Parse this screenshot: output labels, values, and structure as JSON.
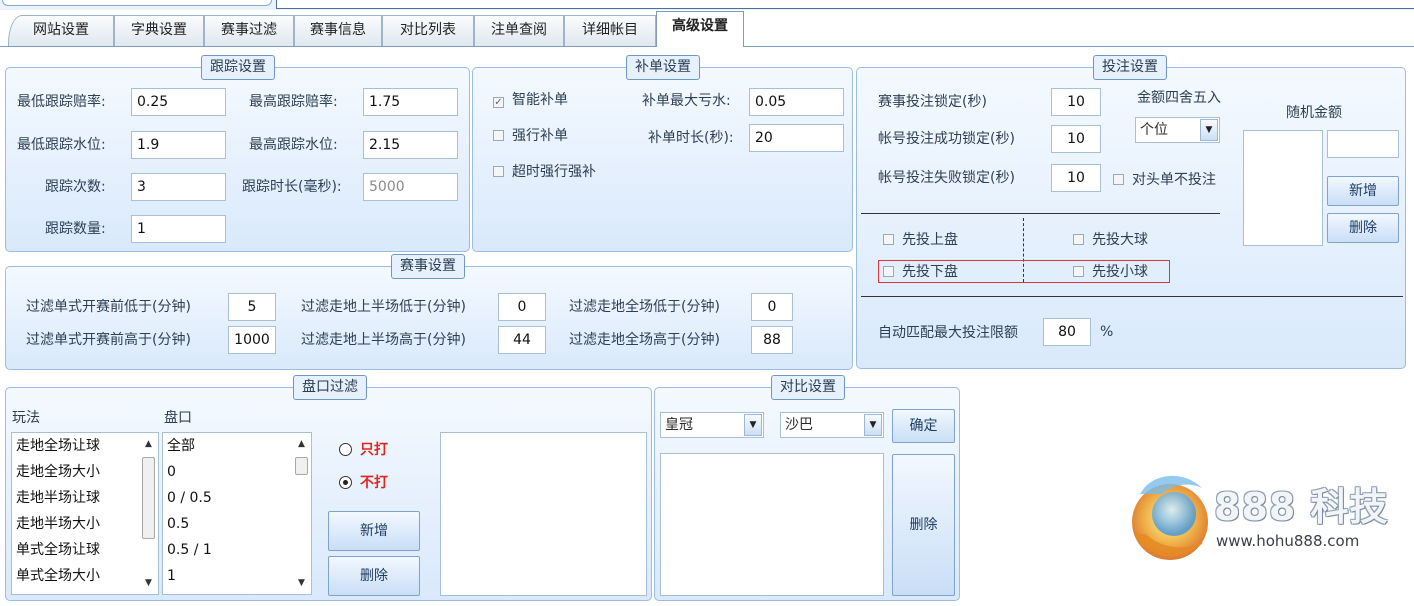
{
  "tabs": [
    "网站设置",
    "字典设置",
    "赛事过滤",
    "赛事信息",
    "对比列表",
    "注单查阅",
    "详细帐目",
    "高级设置"
  ],
  "tracking": {
    "title": "跟踪设置",
    "min_odds_label": "最低跟踪赔率:",
    "min_odds": "0.25",
    "max_odds_label": "最高跟踪赔率:",
    "max_odds": "1.75",
    "min_water_label": "最低跟踪水位:",
    "min_water": "1.9",
    "max_water_label": "最高跟踪水位:",
    "max_water": "2.15",
    "count_label": "跟踪次数:",
    "count": "3",
    "duration_label": "跟踪时长(毫秒):",
    "duration": "5000",
    "quantity_label": "跟踪数量:",
    "quantity": "1"
  },
  "supplement": {
    "title": "补单设置",
    "smart_label": "智能补单",
    "smart_checked": true,
    "forced_label": "强行补单",
    "forced_checked": false,
    "timeout_label": "超时强行强补",
    "timeout_checked": false,
    "max_loss_label": "补单最大亏水:",
    "max_loss": "0.05",
    "duration_label": "补单时长(秒):",
    "duration": "20"
  },
  "betting": {
    "title": "投注设置",
    "event_lock_label": "赛事投注锁定(秒)",
    "event_lock": "10",
    "success_lock_label": "帐号投注成功锁定(秒)",
    "success_lock": "10",
    "fail_lock_label": "帐号投注失败锁定(秒)",
    "fail_lock": "10",
    "rounding_label": "金额四舍五入",
    "rounding_value": "个位",
    "no_opposite_label": "对头单不投注",
    "random_amount_label": "随机金额",
    "add_label": "新增",
    "delete_label": "删除",
    "first_upper_label": "先投上盘",
    "first_big_label": "先投大球",
    "first_lower_label": "先投下盘",
    "first_small_label": "先投小球",
    "auto_match_label": "自动匹配最大投注限额",
    "auto_match_value": "80",
    "percent": "%"
  },
  "events": {
    "title": "赛事设置",
    "pre_low_label": "过滤单式开赛前低于(分钟)",
    "pre_low": "5",
    "pre_high_label": "过滤单式开赛前高于(分钟)",
    "pre_high": "1000",
    "half_low_label": "过滤走地上半场低于(分钟)",
    "half_low": "0",
    "half_high_label": "过滤走地上半场高于(分钟)",
    "half_high": "44",
    "full_low_label": "过滤走地全场低于(分钟)",
    "full_low": "0",
    "full_high_label": "过滤走地全场高于(分钟)",
    "full_high": "88"
  },
  "handicap": {
    "title": "盘口过滤",
    "play_header": "玩法",
    "line_header": "盘口",
    "plays": [
      "走地全场让球",
      "走地全场大小",
      "走地半场让球",
      "走地半场大小",
      "单式全场让球",
      "单式全场大小"
    ],
    "lines": [
      "全部",
      "0",
      "0 / 0.5",
      "0.5",
      "0.5 / 1",
      "1"
    ],
    "only_label": "只打",
    "not_label": "不打",
    "add_label": "新增",
    "delete_label": "删除"
  },
  "compare": {
    "title": "对比设置",
    "site_a": "皇冠",
    "site_b": "沙巴",
    "confirm_label": "确定",
    "delete_label": "删除"
  },
  "brand": {
    "name": "888 科技",
    "site": "www.hohu888.com"
  }
}
